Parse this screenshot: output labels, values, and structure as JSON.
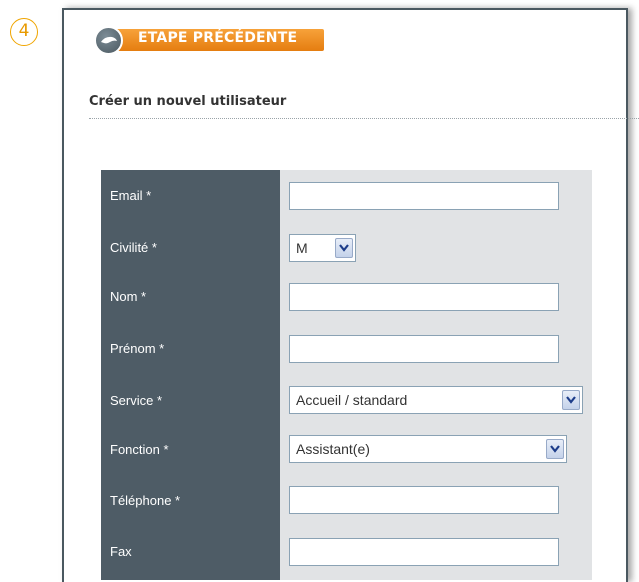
{
  "step": {
    "number": "4"
  },
  "back_button": {
    "label": "ETAPE PRÉCÉDENTE"
  },
  "page": {
    "title": "Créer un nouvel utilisateur"
  },
  "form": {
    "fields": [
      {
        "label": "Email *",
        "value": ""
      },
      {
        "label": "Civilité *",
        "value": "M"
      },
      {
        "label": "Nom *",
        "value": ""
      },
      {
        "label": "Prénom *",
        "value": ""
      },
      {
        "label": "Service *",
        "value": "Accueil / standard"
      },
      {
        "label": "Fonction *",
        "value": "Assistant(e)"
      },
      {
        "label": "Téléphone *",
        "value": ""
      },
      {
        "label": "Fax",
        "value": ""
      }
    ]
  },
  "icons": {
    "back": "dolphin-circle-icon",
    "dropdown": "chevron-down-icon"
  },
  "colors": {
    "accent": "#f28a1a",
    "label_column": "#4e5c66",
    "form_bg": "#e1e3e5"
  }
}
